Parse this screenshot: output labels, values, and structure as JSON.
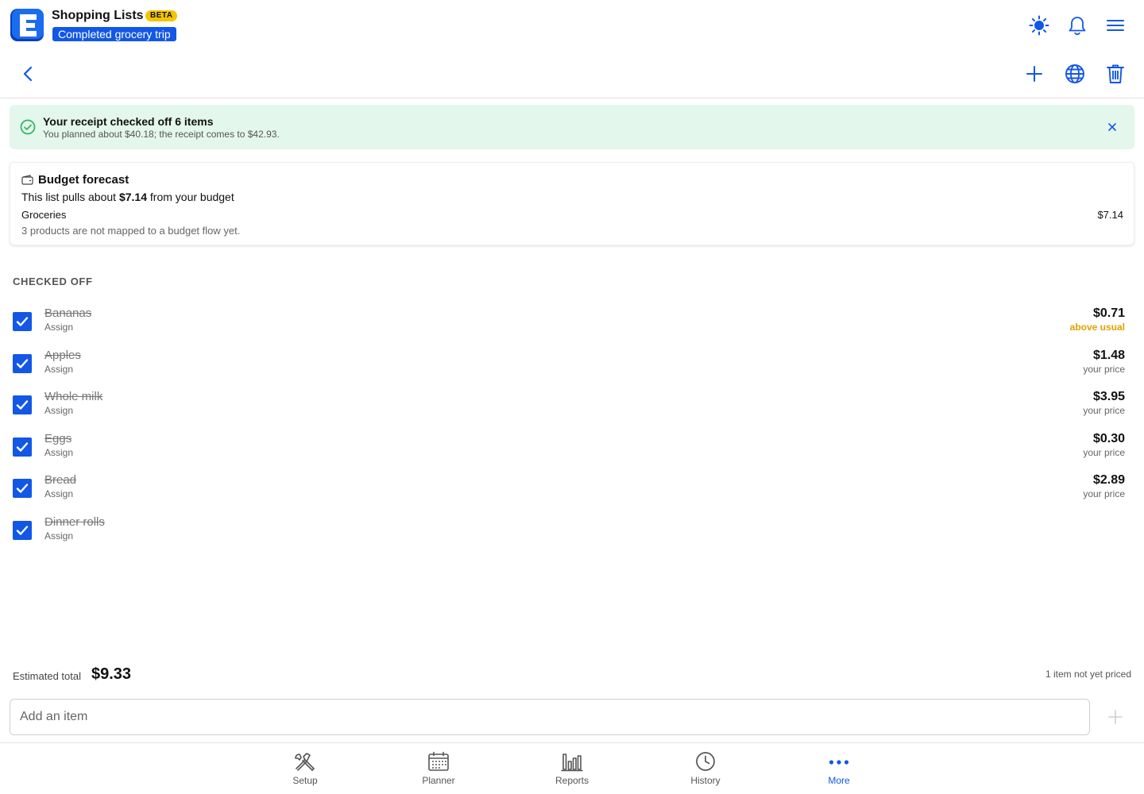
{
  "app": {
    "title": "Shopping Lists",
    "badge": "BETA",
    "subtitle": "Completed grocery trip",
    "accent": "#1257e6",
    "logo_letter": "E"
  },
  "header_icons": [
    "sun-icon",
    "bell-icon",
    "menu-icon"
  ],
  "toolbar_icons": [
    "back-icon",
    "plus-icon",
    "globe-icon",
    "trash-icon"
  ],
  "alert": {
    "title": "Your receipt checked off 6 items",
    "description": "You planned about $40.18; the receipt comes to $42.93.",
    "color": "#e4f7ec"
  },
  "budget": {
    "title": "Budget forecast",
    "line_prefix": "This list pulls about",
    "line_amount": "$7.14",
    "line_suffix": "from your budget",
    "category": "Groceries",
    "category_amount": "$7.14",
    "note": "3 products are not mapped to a budget flow yet."
  },
  "section_heading": "CHECKED OFF",
  "items": [
    {
      "name": "Bananas",
      "assign": "Assign",
      "price": "$0.71",
      "note": "above usual",
      "warn": true
    },
    {
      "name": "Apples",
      "assign": "Assign",
      "price": "$1.48",
      "note": "your price",
      "warn": false
    },
    {
      "name": "Whole milk",
      "assign": "Assign",
      "price": "$3.95",
      "note": "your price",
      "warn": false
    },
    {
      "name": "Eggs",
      "assign": "Assign",
      "price": "$0.30",
      "note": "your price",
      "warn": false
    },
    {
      "name": "Bread",
      "assign": "Assign",
      "price": "$2.89",
      "note": "your price",
      "warn": false
    },
    {
      "name": "Dinner rolls",
      "assign": "Assign",
      "price": "",
      "note": "",
      "warn": false
    }
  ],
  "totals": {
    "label": "Estimated total",
    "value": "$9.33",
    "unpriced": "1 item not yet priced"
  },
  "add_item": {
    "placeholder": "Add an item",
    "value": ""
  },
  "nav": [
    {
      "label": "Setup",
      "icon": "tools-icon",
      "active": false
    },
    {
      "label": "Planner",
      "icon": "calendar-icon",
      "active": false
    },
    {
      "label": "Reports",
      "icon": "bar-chart-icon",
      "active": false
    },
    {
      "label": "History",
      "icon": "clock-icon",
      "active": false
    },
    {
      "label": "More",
      "icon": "more-dots-icon",
      "active": true
    }
  ]
}
